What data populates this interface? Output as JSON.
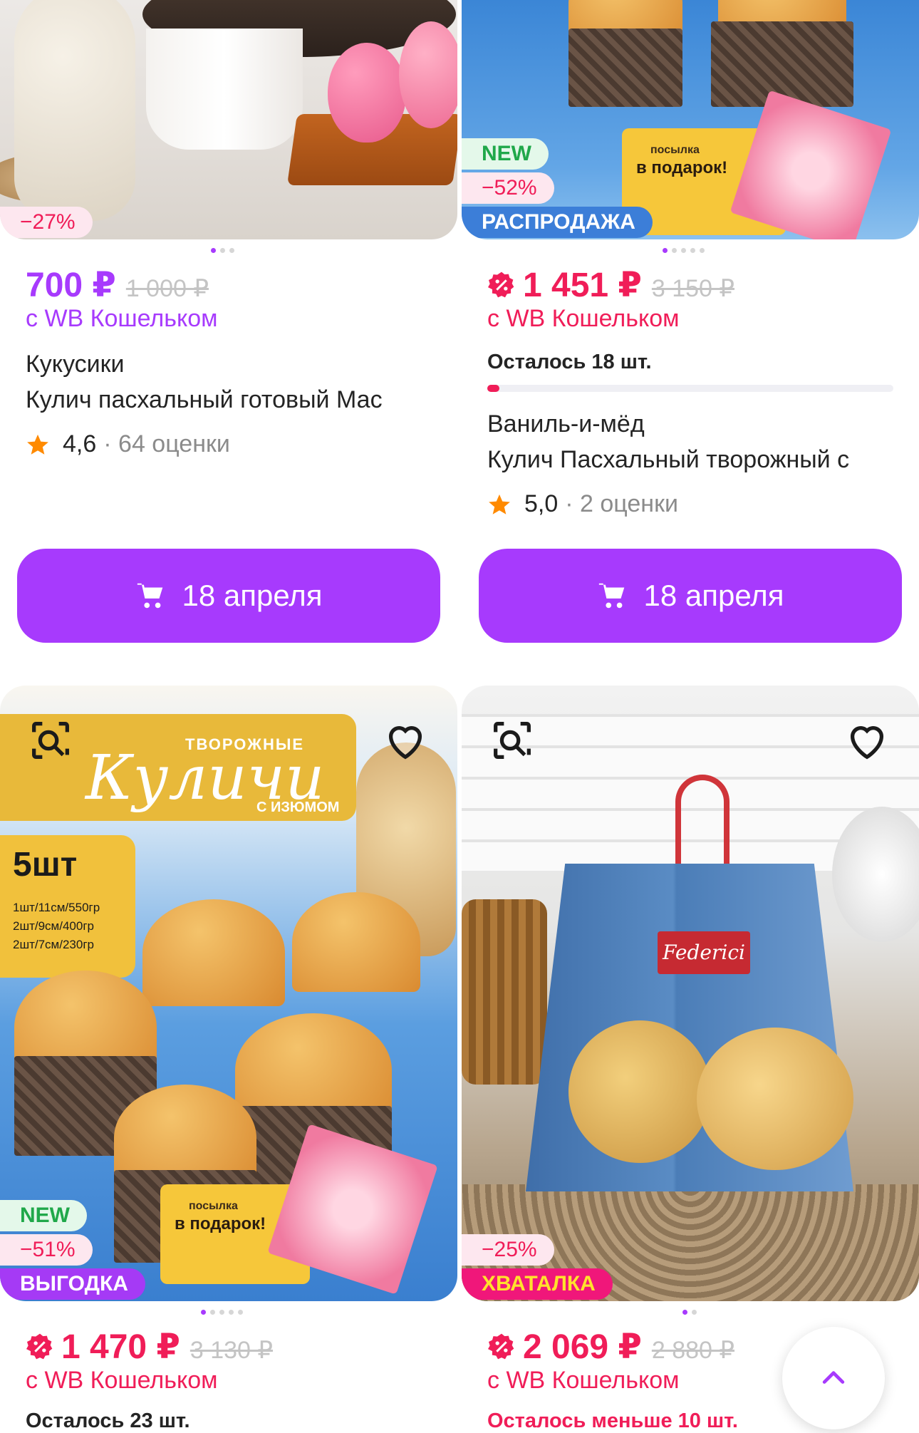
{
  "products": [
    {
      "discount_badge": "−27%",
      "price": "700 ₽",
      "old_price": "1 000 ₽",
      "wallet_label": "с WB Кошельком",
      "brand": "Кукусики",
      "name": "Кулич пасхальный готовый Мас",
      "rating": "4,6",
      "reviews": "· 64 оценки",
      "cart_label": "18 апреля"
    },
    {
      "new_badge": "NEW",
      "discount_badge": "−52%",
      "promo_badge": "РАСПРОДАЖА",
      "promo_color": "#3c7ed8",
      "image_text_1": "посылка",
      "image_text_2": "в подарок!",
      "price": "1 451 ₽",
      "old_price": "3 150 ₽",
      "wallet_label": "с WB Кошельком",
      "remaining": "Осталось 18 шт.",
      "stock_fraction": 0.03,
      "brand": "Ваниль-и-мёд",
      "name": "Кулич Пасхальный творожный с",
      "rating": "5,0",
      "reviews": "· 2 оценки",
      "cart_label": "18 апреля"
    },
    {
      "image_texts": {
        "small": "ТВОРОЖНЫЕ",
        "big": "Куличи",
        "sub": "С ИЗЮМОМ",
        "pcs": "5шт",
        "line1": "1шт/11см/550гр",
        "line2": "2шт/9см/400гр",
        "line3": "2шт/7см/230гр",
        "gift1": "посылка",
        "gift2": "в подарок!"
      },
      "new_badge": "NEW",
      "discount_badge": "−51%",
      "promo_badge": "ВЫГОДКА",
      "price": "1 470 ₽",
      "old_price": "3 130 ₽",
      "wallet_label": "с WB Кошельком",
      "remaining": "Осталось 23 шт."
    },
    {
      "image_texts": {
        "logo": "Federici"
      },
      "discount_badge": "−25%",
      "promo_badge": "ХВАТАЛКА",
      "price": "2 069 ₽",
      "old_price": "2 880 ₽",
      "wallet_label": "с WB Кошельком",
      "remaining": "Осталось меньше 10 шт."
    }
  ],
  "colors": {
    "accent": "#a73afd",
    "sale_red": "#f01d58",
    "new_green": "#20a84a",
    "star": "#ff8a00"
  },
  "icons": [
    "image-search-icon",
    "heart-icon",
    "cart-icon",
    "star-icon",
    "discount-icon",
    "chevron-up-icon"
  ]
}
